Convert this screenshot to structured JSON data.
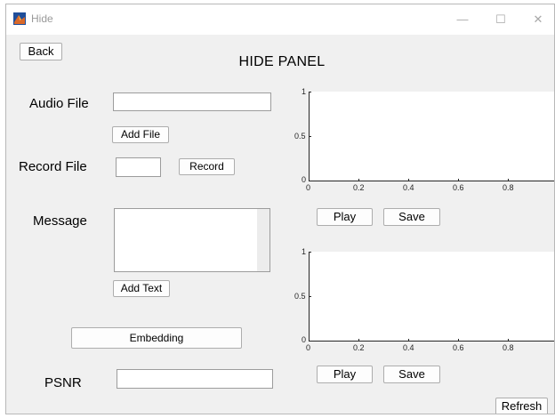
{
  "window": {
    "title": "Hide",
    "controls": {
      "minimize": "—",
      "maximize": "☐",
      "close": "✕"
    }
  },
  "header": {
    "back_label": "Back",
    "panel_title": "HIDE PANEL"
  },
  "audio": {
    "label": "Audio File",
    "path_value": "",
    "add_file_label": "Add File"
  },
  "record": {
    "label": "Record File",
    "value": "",
    "record_label": "Record"
  },
  "message": {
    "label": "Message",
    "text": "",
    "add_text_label": "Add Text"
  },
  "embedding_label": "Embedding",
  "psnr": {
    "label": "PSNR",
    "value": ""
  },
  "plot1": {
    "y_ticks": [
      "0",
      "0.5",
      "1"
    ],
    "x_ticks": [
      "0",
      "0.2",
      "0.4",
      "0.6",
      "0.8"
    ],
    "play_label": "Play",
    "save_label": "Save"
  },
  "plot2": {
    "y_ticks": [
      "0",
      "0.5",
      "1"
    ],
    "x_ticks": [
      "0",
      "0.2",
      "0.4",
      "0.6",
      "0.8"
    ],
    "play_label": "Play",
    "save_label": "Save"
  },
  "refresh_label": "Refresh",
  "chart_data": [
    {
      "type": "line",
      "series": [],
      "xlim": [
        0,
        1
      ],
      "ylim": [
        0,
        1
      ],
      "grid": false
    },
    {
      "type": "line",
      "series": [],
      "xlim": [
        0,
        1
      ],
      "ylim": [
        0,
        1
      ],
      "grid": false
    }
  ]
}
